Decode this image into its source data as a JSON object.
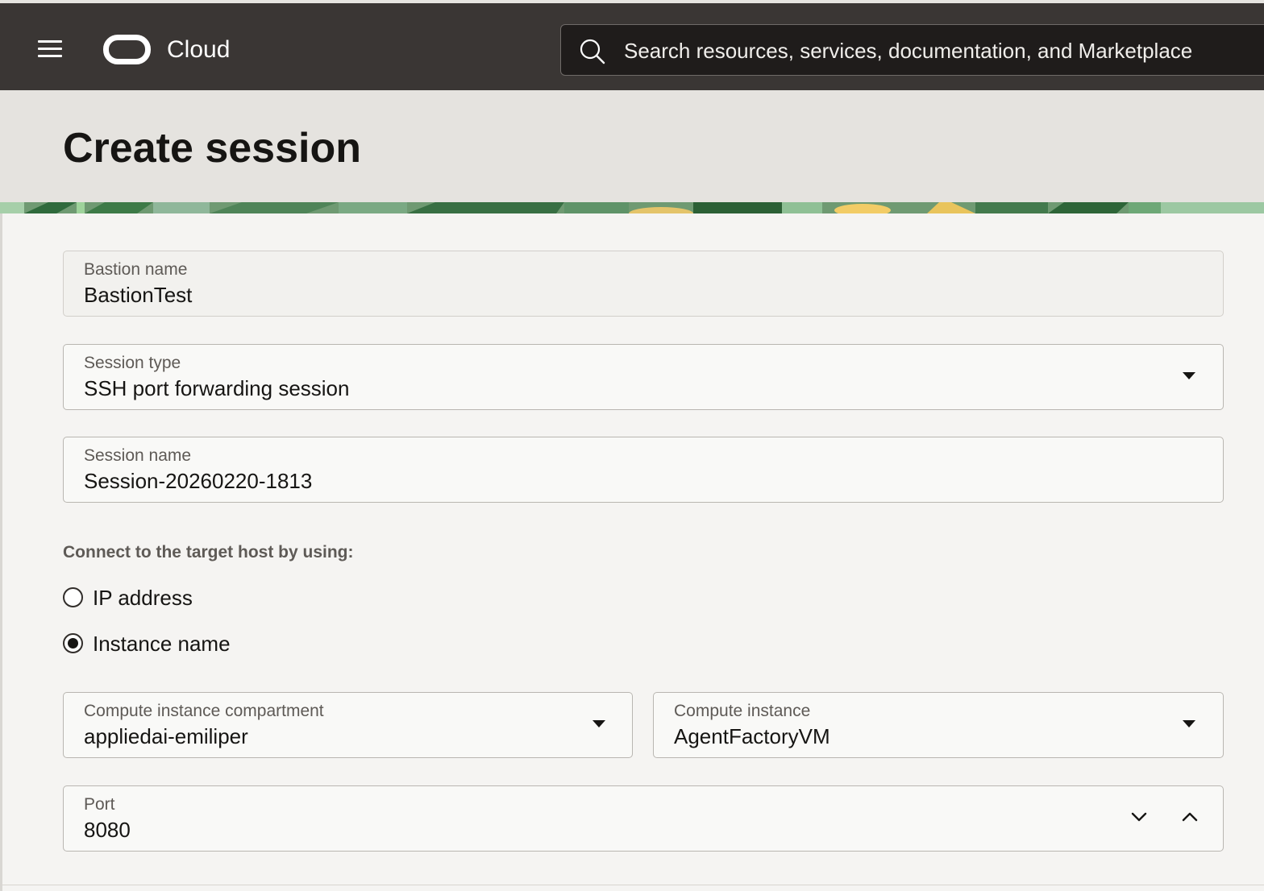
{
  "topbar": {
    "brand": "Cloud",
    "search_placeholder": "Search resources, services, documentation, and Marketplace",
    "menu_icon": "hamburger-menu-icon",
    "logo_icon": "oracle-logo-icon",
    "search_icon": "search-icon"
  },
  "page": {
    "title": "Create session"
  },
  "form": {
    "bastion_name": {
      "label": "Bastion name",
      "value": "BastionTest"
    },
    "session_type": {
      "label": "Session type",
      "value": "SSH port forwarding session"
    },
    "session_name": {
      "label": "Session name",
      "value": "Session-20260220-1813"
    },
    "connect_by": {
      "label": "Connect to the target host by using:",
      "options": [
        {
          "label": "IP address",
          "selected": false
        },
        {
          "label": "Instance name",
          "selected": true
        }
      ]
    },
    "compartment": {
      "label": "Compute instance compartment",
      "value": "appliedai-emiliper"
    },
    "instance": {
      "label": "Compute instance",
      "value": "AgentFactoryVM"
    },
    "port": {
      "label": "Port",
      "value": "8080"
    }
  },
  "colors": {
    "topbar_bg": "#3a3634",
    "header_bg": "#e5e3df",
    "page_bg": "#f5f4f2"
  }
}
